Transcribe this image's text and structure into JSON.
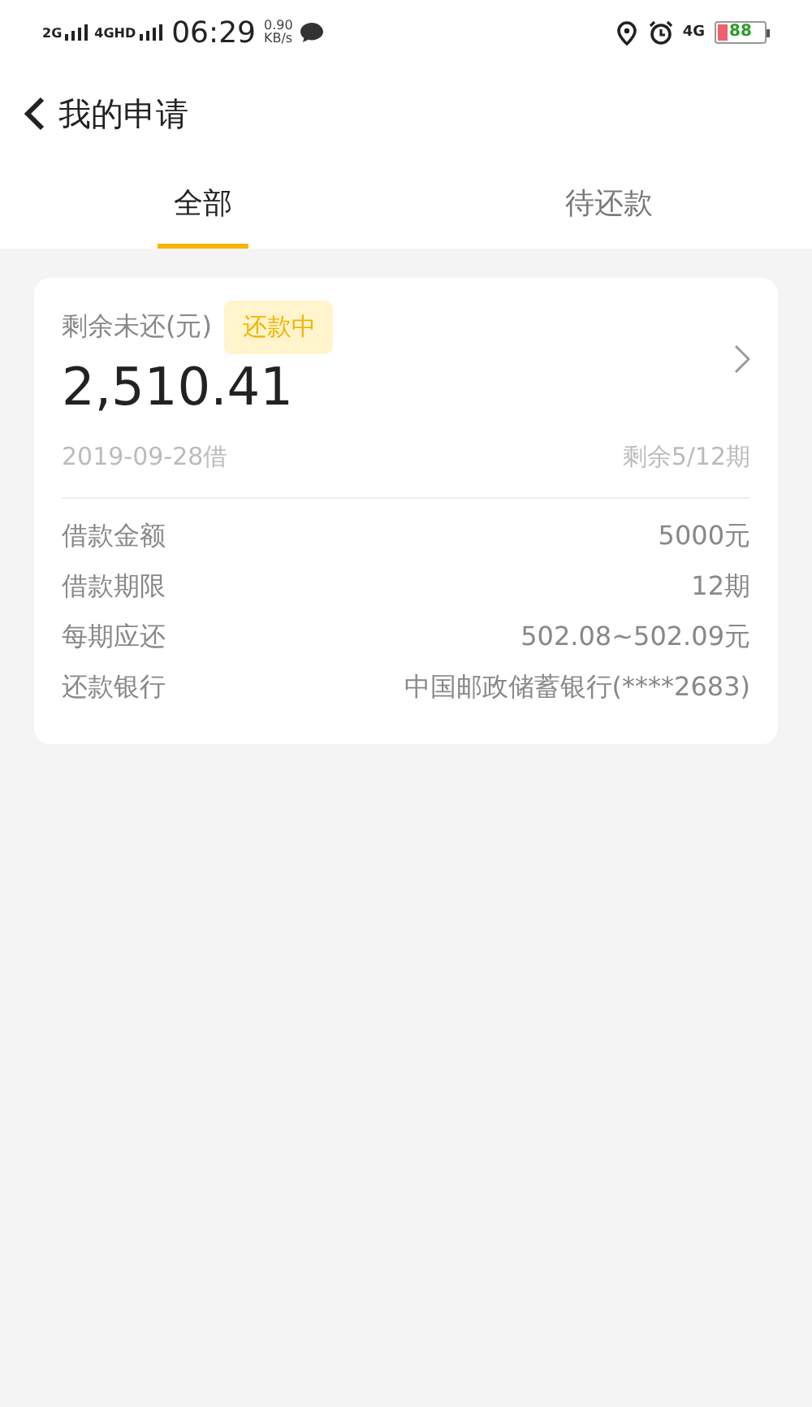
{
  "status_bar": {
    "signal_1": "2G",
    "signal_2": "4GHD",
    "time": "06:29",
    "speed": "0.90",
    "speed_unit": "KB/s",
    "network": "4G",
    "battery": "88"
  },
  "header": {
    "title": "我的申请"
  },
  "tabs": [
    {
      "label": "全部",
      "selected": true
    },
    {
      "label": "待还款",
      "selected": false
    }
  ],
  "loan_card": {
    "label": "剩余未还(元)",
    "status": "还款中",
    "amount": "2,510.41",
    "date": "2019-09-28借",
    "remaining": "剩余5/12期",
    "details": [
      {
        "label": "借款金额",
        "value": "5000元"
      },
      {
        "label": "借款期限",
        "value": "12期"
      },
      {
        "label": "每期应还",
        "value": "502.08~502.09元"
      },
      {
        "label": "还款银行",
        "value": "中国邮政储蓄银行(****2683)"
      }
    ]
  }
}
